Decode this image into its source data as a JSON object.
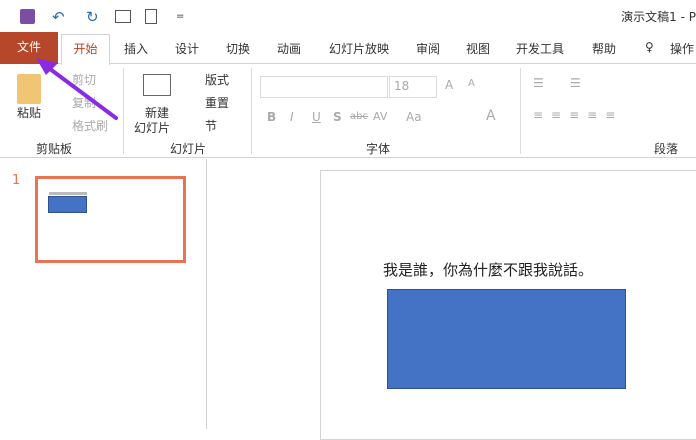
{
  "window": {
    "title": "演示文稿1  -  P"
  },
  "qat": {
    "save": "save-icon",
    "undo": "↶",
    "redo": "↻",
    "more": "="
  },
  "tabs": {
    "file": "文件",
    "items": [
      "开始",
      "插入",
      "设计",
      "切换",
      "动画",
      "幻灯片放映",
      "审阅",
      "视图",
      "开发工具",
      "帮助"
    ],
    "tell": "操作"
  },
  "ribbon": {
    "clipboard": {
      "paste": "粘贴",
      "cut": "剪切",
      "copy": "复制",
      "format_painter": "格式刷",
      "label": "剪贴板"
    },
    "slides": {
      "new_slide_1": "新建",
      "new_slide_2": "幻灯片",
      "layout": "版式",
      "reset": "重置",
      "section": "节",
      "label": "幻灯片"
    },
    "font": {
      "size": "18",
      "bold": "B",
      "italic": "I",
      "underline": "U",
      "shadow": "S",
      "strike": "abc",
      "spacing": "AV",
      "case": "Aa",
      "color": "A",
      "label": "字体"
    },
    "paragraph": {
      "label": "段落"
    }
  },
  "thumbnails": [
    {
      "number": "1"
    }
  ],
  "slide": {
    "text": "我是誰，你為什麼不跟我說話。",
    "shape_color": "#4472c4"
  },
  "colors": {
    "file_tab": "#b7472a",
    "accent": "#c43e1c",
    "thumb_border": "#e97352",
    "arrow": "#8a2be2"
  }
}
